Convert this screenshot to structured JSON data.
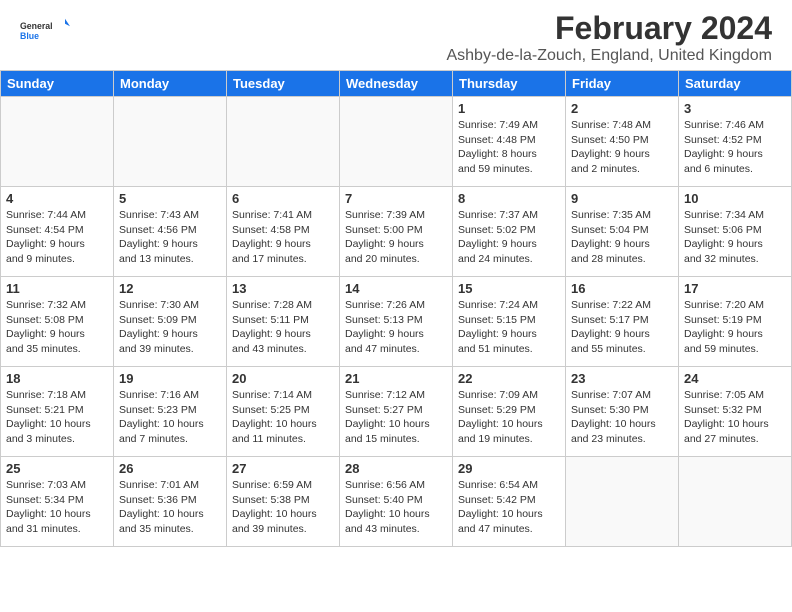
{
  "header": {
    "title": "February 2024",
    "location": "Ashby-de-la-Zouch, England, United Kingdom",
    "logo_general": "General",
    "logo_blue": "Blue"
  },
  "days_of_week": [
    "Sunday",
    "Monday",
    "Tuesday",
    "Wednesday",
    "Thursday",
    "Friday",
    "Saturday"
  ],
  "weeks": [
    [
      {
        "day": "",
        "info": ""
      },
      {
        "day": "",
        "info": ""
      },
      {
        "day": "",
        "info": ""
      },
      {
        "day": "",
        "info": ""
      },
      {
        "day": "1",
        "info": "Sunrise: 7:49 AM\nSunset: 4:48 PM\nDaylight: 8 hours\nand 59 minutes."
      },
      {
        "day": "2",
        "info": "Sunrise: 7:48 AM\nSunset: 4:50 PM\nDaylight: 9 hours\nand 2 minutes."
      },
      {
        "day": "3",
        "info": "Sunrise: 7:46 AM\nSunset: 4:52 PM\nDaylight: 9 hours\nand 6 minutes."
      }
    ],
    [
      {
        "day": "4",
        "info": "Sunrise: 7:44 AM\nSunset: 4:54 PM\nDaylight: 9 hours\nand 9 minutes."
      },
      {
        "day": "5",
        "info": "Sunrise: 7:43 AM\nSunset: 4:56 PM\nDaylight: 9 hours\nand 13 minutes."
      },
      {
        "day": "6",
        "info": "Sunrise: 7:41 AM\nSunset: 4:58 PM\nDaylight: 9 hours\nand 17 minutes."
      },
      {
        "day": "7",
        "info": "Sunrise: 7:39 AM\nSunset: 5:00 PM\nDaylight: 9 hours\nand 20 minutes."
      },
      {
        "day": "8",
        "info": "Sunrise: 7:37 AM\nSunset: 5:02 PM\nDaylight: 9 hours\nand 24 minutes."
      },
      {
        "day": "9",
        "info": "Sunrise: 7:35 AM\nSunset: 5:04 PM\nDaylight: 9 hours\nand 28 minutes."
      },
      {
        "day": "10",
        "info": "Sunrise: 7:34 AM\nSunset: 5:06 PM\nDaylight: 9 hours\nand 32 minutes."
      }
    ],
    [
      {
        "day": "11",
        "info": "Sunrise: 7:32 AM\nSunset: 5:08 PM\nDaylight: 9 hours\nand 35 minutes."
      },
      {
        "day": "12",
        "info": "Sunrise: 7:30 AM\nSunset: 5:09 PM\nDaylight: 9 hours\nand 39 minutes."
      },
      {
        "day": "13",
        "info": "Sunrise: 7:28 AM\nSunset: 5:11 PM\nDaylight: 9 hours\nand 43 minutes."
      },
      {
        "day": "14",
        "info": "Sunrise: 7:26 AM\nSunset: 5:13 PM\nDaylight: 9 hours\nand 47 minutes."
      },
      {
        "day": "15",
        "info": "Sunrise: 7:24 AM\nSunset: 5:15 PM\nDaylight: 9 hours\nand 51 minutes."
      },
      {
        "day": "16",
        "info": "Sunrise: 7:22 AM\nSunset: 5:17 PM\nDaylight: 9 hours\nand 55 minutes."
      },
      {
        "day": "17",
        "info": "Sunrise: 7:20 AM\nSunset: 5:19 PM\nDaylight: 9 hours\nand 59 minutes."
      }
    ],
    [
      {
        "day": "18",
        "info": "Sunrise: 7:18 AM\nSunset: 5:21 PM\nDaylight: 10 hours\nand 3 minutes."
      },
      {
        "day": "19",
        "info": "Sunrise: 7:16 AM\nSunset: 5:23 PM\nDaylight: 10 hours\nand 7 minutes."
      },
      {
        "day": "20",
        "info": "Sunrise: 7:14 AM\nSunset: 5:25 PM\nDaylight: 10 hours\nand 11 minutes."
      },
      {
        "day": "21",
        "info": "Sunrise: 7:12 AM\nSunset: 5:27 PM\nDaylight: 10 hours\nand 15 minutes."
      },
      {
        "day": "22",
        "info": "Sunrise: 7:09 AM\nSunset: 5:29 PM\nDaylight: 10 hours\nand 19 minutes."
      },
      {
        "day": "23",
        "info": "Sunrise: 7:07 AM\nSunset: 5:30 PM\nDaylight: 10 hours\nand 23 minutes."
      },
      {
        "day": "24",
        "info": "Sunrise: 7:05 AM\nSunset: 5:32 PM\nDaylight: 10 hours\nand 27 minutes."
      }
    ],
    [
      {
        "day": "25",
        "info": "Sunrise: 7:03 AM\nSunset: 5:34 PM\nDaylight: 10 hours\nand 31 minutes."
      },
      {
        "day": "26",
        "info": "Sunrise: 7:01 AM\nSunset: 5:36 PM\nDaylight: 10 hours\nand 35 minutes."
      },
      {
        "day": "27",
        "info": "Sunrise: 6:59 AM\nSunset: 5:38 PM\nDaylight: 10 hours\nand 39 minutes."
      },
      {
        "day": "28",
        "info": "Sunrise: 6:56 AM\nSunset: 5:40 PM\nDaylight: 10 hours\nand 43 minutes."
      },
      {
        "day": "29",
        "info": "Sunrise: 6:54 AM\nSunset: 5:42 PM\nDaylight: 10 hours\nand 47 minutes."
      },
      {
        "day": "",
        "info": ""
      },
      {
        "day": "",
        "info": ""
      }
    ]
  ]
}
